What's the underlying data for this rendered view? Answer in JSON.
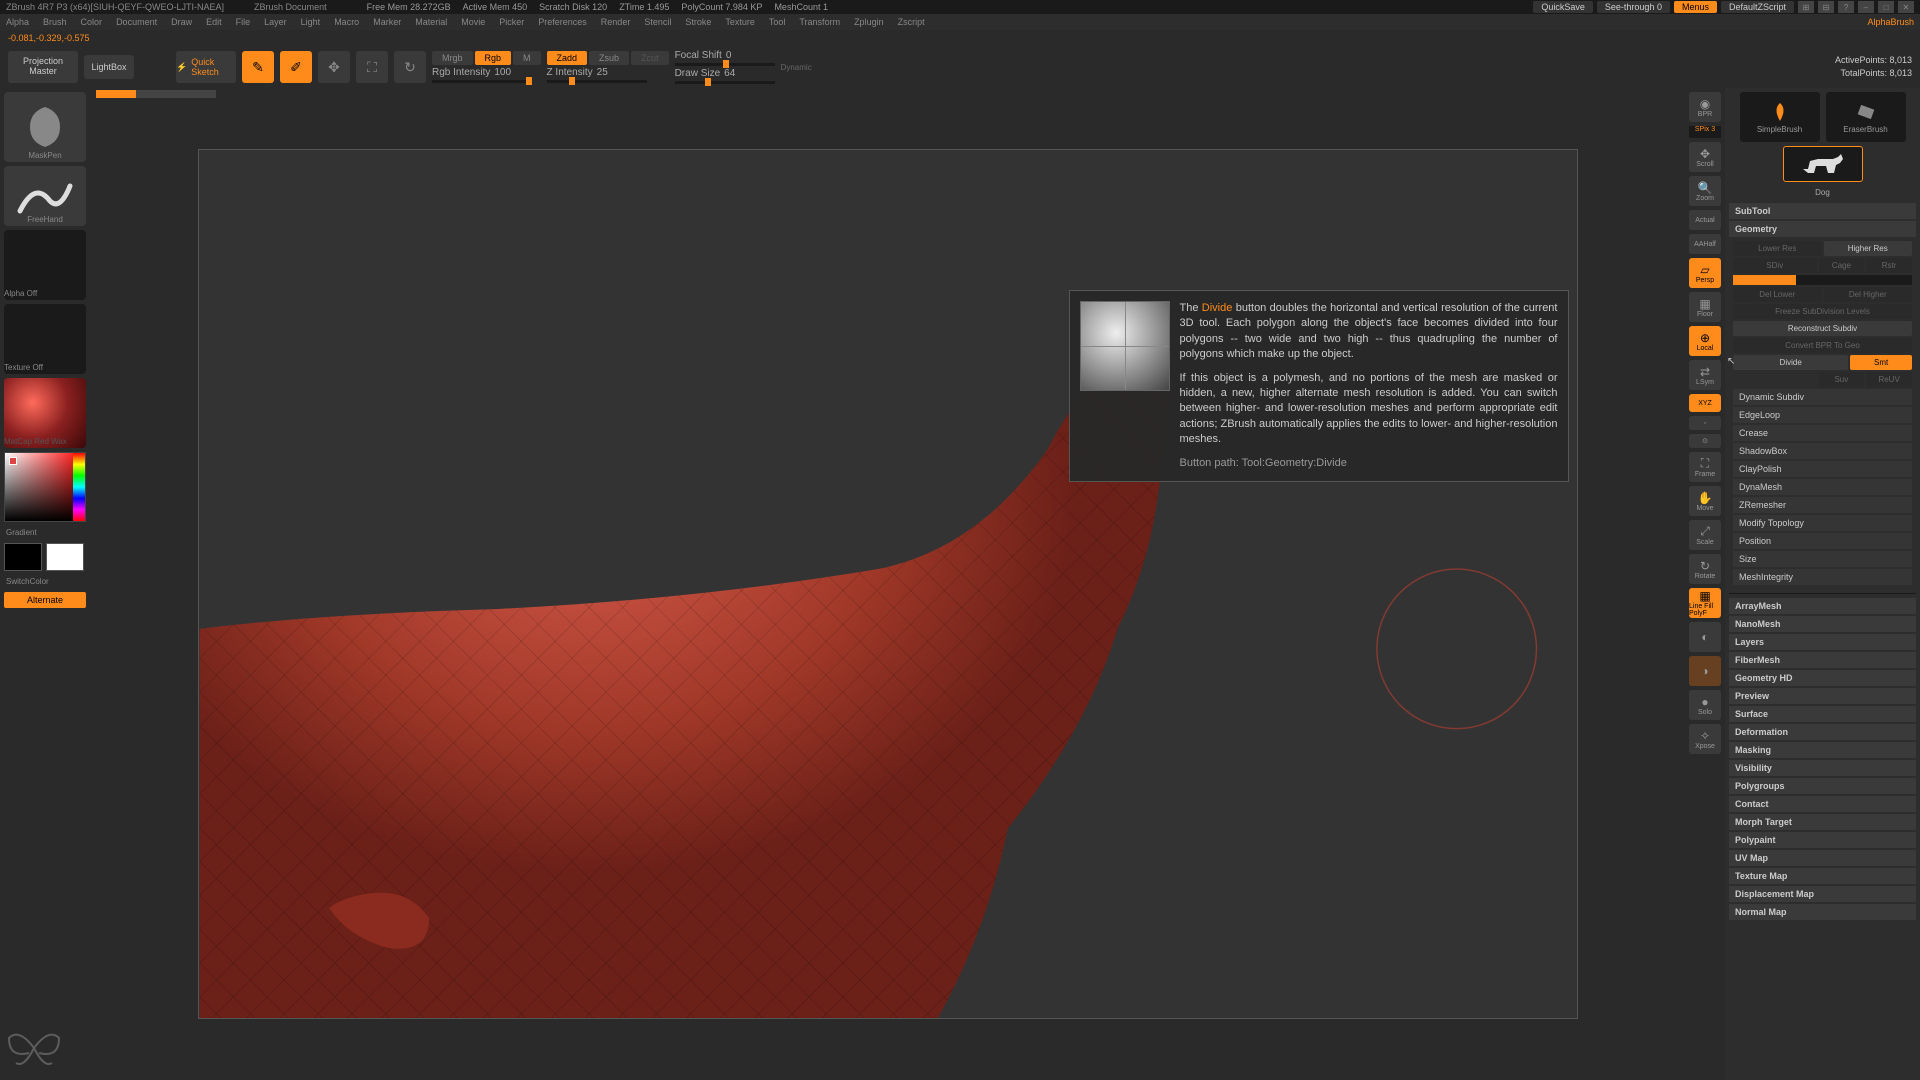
{
  "titlebar": {
    "app": "ZBrush 4R7 P3 (x64)[SIUH-QEYF-QWEO-LJTI-NAEA]",
    "doc": "ZBrush Document",
    "stats": [
      "Free Mem 28.272GB",
      "Active Mem 450",
      "Scratch Disk 120",
      "ZTime 1.495",
      "PolyCount 7.984 KP",
      "MeshCount 1"
    ],
    "quicksave": "QuickSave",
    "seethrough": "See-through  0",
    "menus": "Menus",
    "defaultscript": "DefaultZScript"
  },
  "menubar": [
    "Alpha",
    "Brush",
    "Color",
    "Document",
    "Draw",
    "Edit",
    "File",
    "Layer",
    "Light",
    "Macro",
    "Marker",
    "Material",
    "Movie",
    "Picker",
    "Preferences",
    "Render",
    "Stencil",
    "Stroke",
    "Texture",
    "Tool",
    "Transform",
    "Zplugin",
    "Zscript"
  ],
  "statusline": "-0.081,-0.329,-0.575",
  "toptools": {
    "proj_master": "Projection Master",
    "lightbox": "LightBox",
    "quick_sketch": "Quick Sketch",
    "modes": {
      "mrgb": "Mrgb",
      "rgb": "Rgb",
      "m": "M",
      "zadd": "Zadd",
      "zsub": "Zsub",
      "zcut": "Zcut"
    },
    "rgb_intensity_label": "Rgb Intensity",
    "rgb_intensity_val": "100",
    "z_intensity_label": "Z Intensity",
    "z_intensity_val": "25",
    "focal_label": "Focal Shift",
    "focal_val": "0",
    "draw_label": "Draw Size",
    "draw_val": "64",
    "dynamic": "Dynamic",
    "active_points": "ActivePoints: 8,013",
    "total_points": "TotalPoints: 8,013"
  },
  "leftbar": {
    "brush": "MaskPen",
    "stroke": "FreeHand",
    "alpha": "Alpha Off",
    "texture": "Texture Off",
    "material": "MatCap Red Wax",
    "gradient": "Gradient",
    "switch": "SwitchColor",
    "alternate": "Alternate"
  },
  "rail": {
    "bpr": "BPR",
    "spix": "SPix 3",
    "scroll": "Scroll",
    "zoom": "Zoom",
    "actual": "Actual",
    "aahalf": "AAHalf",
    "persp": "Persp",
    "floor": "Floor",
    "local": "Local",
    "lsym": "LSym",
    "xyz": "XYZ",
    "frame": "Frame",
    "move": "Move",
    "scale": "Scale",
    "rotate": "Rotate",
    "polyf": "Line Fill PolyF",
    "solo": "Solo",
    "xpose": "Xpose"
  },
  "tooltip": {
    "kw": "Divide",
    "p1a": "The ",
    "p1b": " button doubles the horizontal and vertical resolution of the current 3D tool. Each polygon along the object's face becomes divided into four polygons -- two wide and two high -- thus quadrupling the number of polygons which make up the object.",
    "p2": "If this object is a polymesh, and no portions of the mesh are masked or hidden, a new, higher alternate mesh resolution is added. You can switch between higher- and lower-resolution meshes and perform appropriate edit actions; ZBrush automatically applies the edits to lower- and higher-resolution meshes.",
    "path": "Button path: Tool:Geometry:Divide"
  },
  "rightpanel": {
    "brushes": [
      "SimpleBrush",
      "EraserBrush"
    ],
    "tool": "Dog",
    "sections_top": [
      "SubTool",
      "Geometry"
    ],
    "geo": {
      "lower": "Lower Res",
      "higher": "Higher Res",
      "sdiv": "SDiv",
      "cage": "Cage",
      "rstr": "Rstr",
      "del_lower": "Del Lower",
      "del_higher": "Del Higher",
      "freeze": "Freeze SubDivision Levels",
      "reconstruct": "Reconstruct Subdiv",
      "convert": "Convert BPR To Geo",
      "divide": "Divide",
      "smt": "Smt",
      "suv": "Suv",
      "reuv": "ReUV",
      "subs": [
        "Dynamic Subdiv",
        "EdgeLoop",
        "Crease",
        "ShadowBox",
        "ClayPolish",
        "DynaMesh",
        "ZRemesher",
        "Modify Topology",
        "Position",
        "Size",
        "MeshIntegrity"
      ]
    },
    "sections_bot": [
      "ArrayMesh",
      "NanoMesh",
      "Layers",
      "FiberMesh",
      "Geometry HD",
      "Preview",
      "Surface",
      "Deformation",
      "Masking",
      "Visibility",
      "Polygroups",
      "Contact",
      "Morph Target",
      "Polypaint",
      "UV Map",
      "Texture Map",
      "Displacement Map",
      "Normal Map"
    ]
  }
}
